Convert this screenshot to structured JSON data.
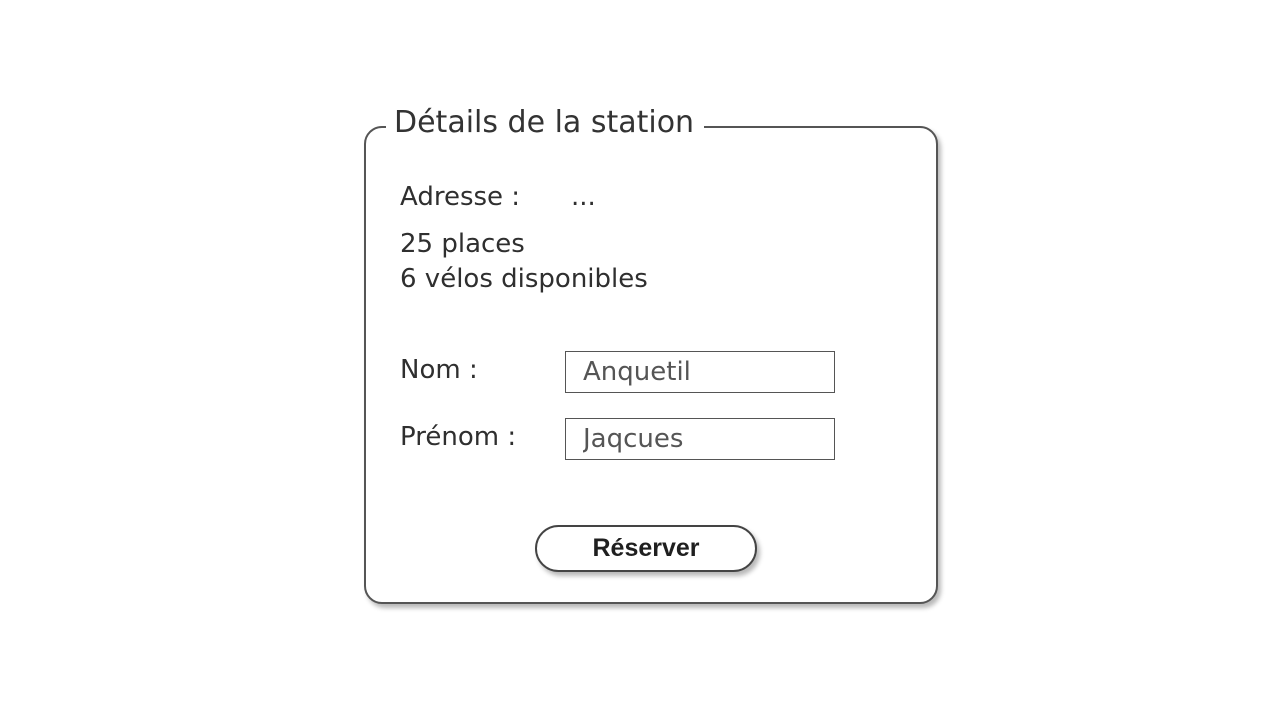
{
  "panel": {
    "title": "Détails de la station"
  },
  "station": {
    "address_label": "Adresse :",
    "address_value": "...",
    "places": "25 places",
    "bikes_available": "6 vélos disponibles"
  },
  "form": {
    "nom_label": "Nom :",
    "nom_value": "Anquetil",
    "prenom_label": "Prénom :",
    "prenom_value": "Jaqcues",
    "submit_label": "Réserver"
  }
}
